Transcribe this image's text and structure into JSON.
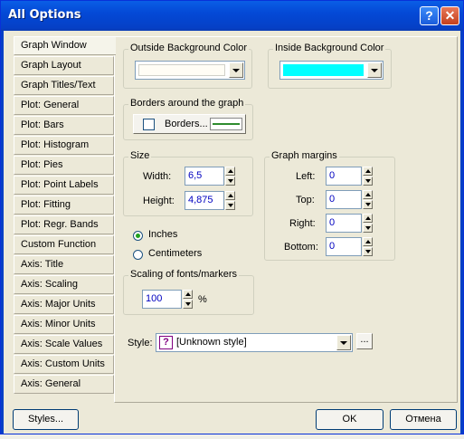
{
  "window": {
    "title": "All Options",
    "help_label": "?",
    "close_label": "✕"
  },
  "tabs": [
    {
      "label": "Graph Window",
      "active": true
    },
    {
      "label": "Graph Layout"
    },
    {
      "label": "Graph Titles/Text"
    },
    {
      "label": "Plot: General"
    },
    {
      "label": "Plot: Bars"
    },
    {
      "label": "Plot: Histogram"
    },
    {
      "label": "Plot: Pies"
    },
    {
      "label": "Plot: Point Labels"
    },
    {
      "label": "Plot: Fitting"
    },
    {
      "label": "Plot: Regr. Bands"
    },
    {
      "label": "Custom Function"
    },
    {
      "label": "Axis: Title"
    },
    {
      "label": "Axis: Scaling"
    },
    {
      "label": "Axis: Major Units"
    },
    {
      "label": "Axis: Minor Units"
    },
    {
      "label": "Axis: Scale Values"
    },
    {
      "label": "Axis: Custom Units"
    },
    {
      "label": "Axis: General"
    }
  ],
  "outside_bg": {
    "label": "Outside Background Color",
    "color": "#fffdf5"
  },
  "inside_bg": {
    "label": "Inside Background Color",
    "color": "#00ffff"
  },
  "borders": {
    "group_label": "Borders around the graph",
    "button_label": "Borders...",
    "checked": false,
    "line_color": "#2e8b2e"
  },
  "size": {
    "group_label": "Size",
    "width_label": "Width:",
    "width_value": "6,5",
    "height_label": "Height:",
    "height_value": "4,875"
  },
  "units": {
    "inches_label": "Inches",
    "centimeters_label": "Centimeters",
    "selected": "inches"
  },
  "margins": {
    "group_label": "Graph margins",
    "left_label": "Left:",
    "left_value": "0",
    "top_label": "Top:",
    "top_value": "0",
    "right_label": "Right:",
    "right_value": "0",
    "bottom_label": "Bottom:",
    "bottom_value": "0"
  },
  "scaling": {
    "group_label": "Scaling of fonts/markers",
    "value": "100",
    "unit": "%"
  },
  "style": {
    "label": "Style:",
    "icon": "?",
    "value": "[Unknown style]",
    "browse_label": "..."
  },
  "buttons": {
    "styles": "Styles...",
    "ok": "OK",
    "cancel": "Отмена"
  }
}
